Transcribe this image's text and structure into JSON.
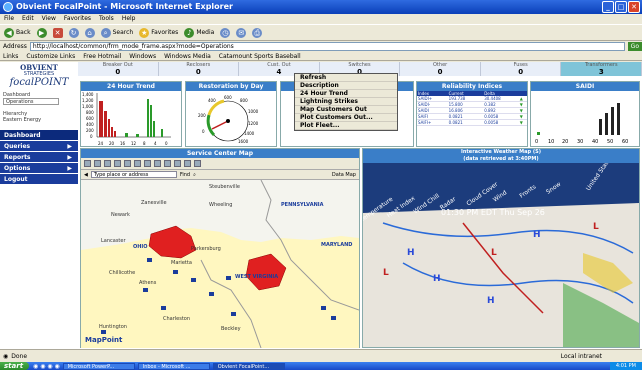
{
  "window": {
    "title": "Obvient FocalPoint - Microsoft Internet Explorer"
  },
  "menu": [
    "File",
    "Edit",
    "View",
    "Favorites",
    "Tools",
    "Help"
  ],
  "toolbar": {
    "back": "Back",
    "search": "Search",
    "favorites": "Favorites",
    "media": "Media"
  },
  "address": {
    "label": "Address",
    "url": "http://localhost/common/frm_mode_frame.aspx?mode=Operations",
    "go": "Go"
  },
  "links": {
    "label": "Links",
    "items": [
      "Customize Links",
      "Free Hotmail",
      "Windows",
      "Windows Media",
      "Catamount Sports Baseball"
    ]
  },
  "logo": {
    "line1": "OBVIENT",
    "line2": "STRATEGIES",
    "line3": "focalPOINT"
  },
  "status_strip": [
    {
      "label": "Breaker Out",
      "value": "0"
    },
    {
      "label": "Reclosers",
      "value": "0"
    },
    {
      "label": "Cust. Out",
      "value": "4"
    },
    {
      "label": "Switches",
      "value": "0"
    },
    {
      "label": "Other",
      "value": "0"
    },
    {
      "label": "Fuses",
      "value": "0"
    },
    {
      "label": "Transformers",
      "value": "3"
    }
  ],
  "sidebar": {
    "dashboard_label": "Dashboard",
    "dashboard_value": "Operations",
    "hierarchy_label": "Hierarchy",
    "hierarchy_value": "Eastern Energy",
    "nav": [
      "Dashboard",
      "Queries",
      "Reports",
      "Options",
      "Logout"
    ]
  },
  "panels": {
    "trend": {
      "title": "24 Hour Trend",
      "y_ticks": [
        "1,400",
        "1,200",
        "1,000",
        "800",
        "600",
        "400",
        "200",
        "0"
      ],
      "x_ticks": [
        "24",
        "20",
        "16",
        "12",
        "8",
        "4",
        "0"
      ]
    },
    "restoration": {
      "title": "Restoration by Day",
      "ticks": [
        "400",
        "600",
        "800",
        "1000",
        "1200",
        "1400",
        "1600",
        "200",
        "0"
      ]
    },
    "reliability": {
      "title": "Reliability Indices",
      "headers": [
        "Index",
        "Current",
        "Delta",
        ""
      ],
      "rows": [
        [
          "SAIDI+",
          "193.738",
          "30.4408"
        ],
        [
          "SAIDI-",
          "15.800",
          "0.382"
        ],
        [
          "SAIDI",
          "16.806",
          "0.892"
        ],
        [
          "SAIFI",
          "0.0821",
          "0.0058"
        ],
        [
          "SAIFI+",
          "0.0821",
          "0.0058"
        ]
      ]
    },
    "saidi": {
      "title": "SAIDI",
      "ticks": [
        "0",
        "10",
        "20",
        "30",
        "40",
        "50",
        "60"
      ]
    },
    "map": {
      "title": "Service Center Map",
      "find_placeholder": "Type place or address",
      "find_label": "Find",
      "legend": "Data Map",
      "places": [
        "Steubenville",
        "Newark",
        "Zanesville",
        "Wheeling",
        "Lancaster",
        "Marietta",
        "Parkersburg",
        "Chillicothe",
        "Athens",
        "Huntington",
        "Charleston",
        "OHIO",
        "PENNSYLVANIA",
        "MARYLAND",
        "WEST VIRGINIA",
        "Beckley"
      ],
      "brand": "MapPoint"
    },
    "weather": {
      "title": "Interactive Weather Map (S)",
      "subtitle": "(data retrieved at 3:40PM)",
      "timestamp": "01:30 PM EDT Thu Sep 26",
      "tabs": [
        "Temperature",
        "Heat Index",
        "Wind Chill",
        "Radar",
        "Cloud Cover",
        "Wind",
        "Fronts",
        "Snow"
      ],
      "country": "United States"
    }
  },
  "context_menu": [
    "Refresh",
    "Description",
    "24 Hour Trend",
    "Lightning Strikes",
    "Map Customers Out",
    "Plot Customers Out...",
    "Plot Fleet..."
  ],
  "statusbar": {
    "done": "Done",
    "zone": "Local intranet"
  },
  "taskbar": {
    "start": "start",
    "tasks": [
      "Microsoft PowerP...",
      "Inbox - Microsoft ...",
      "Obvient FocalPoint..."
    ],
    "clock": "4:01 PM"
  },
  "colors": {
    "accent": "#1a3c9c",
    "title": "#0a3fb8",
    "outage": "#e02020"
  }
}
